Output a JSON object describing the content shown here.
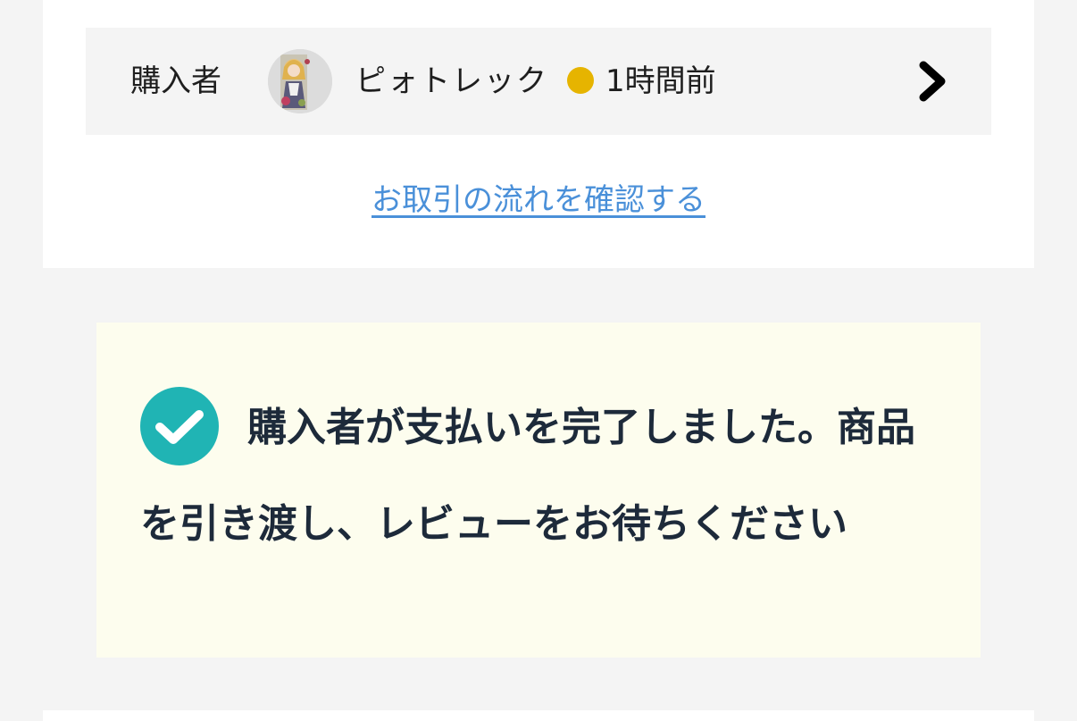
{
  "buyer_row": {
    "label": "購入者",
    "name": "ピォトレック",
    "last_seen": "1時間前",
    "status_color": "#e6b400",
    "avatar_icon": "user-avatar-image",
    "chevron_icon": "chevron-right-icon"
  },
  "flow_link": {
    "label": "お取引の流れを確認する"
  },
  "notice": {
    "icon": "check-circle-icon",
    "accent_color": "#20b4b4",
    "message": "購入者が支払いを完了しました。商品を引き渡し、レビューをお待ちください"
  }
}
